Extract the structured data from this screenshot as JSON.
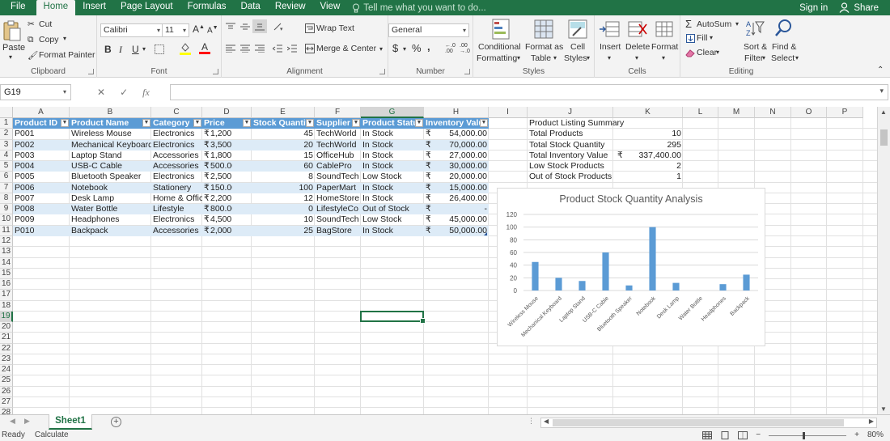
{
  "menu": {
    "tabs": [
      "File",
      "Home",
      "Insert",
      "Page Layout",
      "Formulas",
      "Data",
      "Review",
      "View"
    ],
    "active_tab": "Home",
    "tell_me": "Tell me what you want to do...",
    "sign_in": "Sign in",
    "share": "Share"
  },
  "ribbon": {
    "clipboard": {
      "label": "Clipboard",
      "paste": "Paste",
      "cut": "Cut",
      "copy": "Copy",
      "format_painter": "Format Painter"
    },
    "font": {
      "label": "Font",
      "name": "Calibri",
      "size": "11",
      "bold": "B",
      "italic": "I",
      "underline": "U"
    },
    "alignment": {
      "label": "Alignment",
      "wrap": "Wrap Text",
      "merge": "Merge & Center"
    },
    "number": {
      "label": "Number",
      "format": "General",
      "currency": "$",
      "percent": "%",
      "comma": ",",
      "inc_decimal": ".00",
      "dec_decimal": ".0"
    },
    "styles": {
      "label": "Styles",
      "conditional": "Conditional",
      "conditional2": "Formatting",
      "format_as": "Format as",
      "format_as2": "Table",
      "cell_styles": "Cell",
      "cell_styles2": "Styles"
    },
    "cells": {
      "label": "Cells",
      "insert": "Insert",
      "delete": "Delete",
      "format": "Format"
    },
    "editing": {
      "label": "Editing",
      "autosum": "AutoSum",
      "fill": "Fill",
      "clear": "Clear",
      "sort": "Sort &",
      "sort2": "Filter",
      "find": "Find &",
      "find2": "Select"
    }
  },
  "formula_bar": {
    "name_box": "G19",
    "fx": "fx",
    "value": ""
  },
  "columns": [
    "A",
    "B",
    "C",
    "D",
    "E",
    "F",
    "G",
    "H",
    "I",
    "J",
    "K",
    "L",
    "M",
    "N",
    "O",
    "P"
  ],
  "selected_column": "G",
  "selected_row": 19,
  "rows": 28,
  "table": {
    "headers": [
      "Product ID",
      "Product Name",
      "Category",
      "Price",
      "Stock Quantity",
      "Supplier",
      "Product Status",
      "Inventory Value"
    ],
    "currency_symbol": "₹",
    "rows": [
      [
        "P001",
        "Wireless Mouse",
        "Electronics",
        "1,200.00",
        "45",
        "TechWorld",
        "In Stock",
        "54,000.00"
      ],
      [
        "P002",
        "Mechanical Keyboard",
        "Electronics",
        "3,500.00",
        "20",
        "TechWorld",
        "In Stock",
        "70,000.00"
      ],
      [
        "P003",
        "Laptop Stand",
        "Accessories",
        "1,800.00",
        "15",
        "OfficeHub",
        "In Stock",
        "27,000.00"
      ],
      [
        "P004",
        "USB-C Cable",
        "Accessories",
        "500.00",
        "60",
        "CablePro",
        "In Stock",
        "30,000.00"
      ],
      [
        "P005",
        "Bluetooth Speaker",
        "Electronics",
        "2,500.00",
        "8",
        "SoundTech",
        "Low Stock",
        "20,000.00"
      ],
      [
        "P006",
        "Notebook",
        "Stationery",
        "150.00",
        "100",
        "PaperMart",
        "In Stock",
        "15,000.00"
      ],
      [
        "P007",
        "Desk Lamp",
        "Home & Office",
        "2,200.00",
        "12",
        "HomeStore",
        "In Stock",
        "26,400.00"
      ],
      [
        "P008",
        "Water Bottle",
        "Lifestyle",
        "800.00",
        "0",
        "LifestyleCo",
        "Out of Stock",
        "-"
      ],
      [
        "P009",
        "Headphones",
        "Electronics",
        "4,500.00",
        "10",
        "SoundTech",
        "Low Stock",
        "45,000.00"
      ],
      [
        "P010",
        "Backpack",
        "Accessories",
        "2,000.00",
        "25",
        "BagStore",
        "In Stock",
        "50,000.00"
      ]
    ]
  },
  "summary": {
    "title": "Product Listing Summary",
    "items": [
      {
        "label": "Total Products",
        "value": "10"
      },
      {
        "label": "Total Stock Quantity",
        "value": "295"
      },
      {
        "label": "Total Inventory Value",
        "currency": "₹",
        "value": "337,400.00"
      },
      {
        "label": "Low Stock Products",
        "value": "2"
      },
      {
        "label": "Out of Stock Products",
        "value": "1"
      }
    ]
  },
  "chart_data": {
    "type": "bar",
    "title": "Product Stock Quantity Analysis",
    "categories": [
      "Wireless Mouse",
      "Mechanical Keyboard",
      "Laptop Stand",
      "USB-C Cable",
      "Bluetooth Speaker",
      "Notebook",
      "Desk Lamp",
      "Water Bottle",
      "Headphones",
      "Backpack"
    ],
    "values": [
      45,
      20,
      15,
      60,
      8,
      100,
      12,
      0,
      10,
      25
    ],
    "ylim": [
      0,
      120
    ],
    "yticks": [
      "0",
      "20",
      "40",
      "60",
      "80",
      "100",
      "120"
    ],
    "grid": true,
    "bar_color": "#5b9bd5"
  },
  "sheet": {
    "tab": "Sheet1",
    "add": "+"
  },
  "status": {
    "ready": "Ready",
    "calculate": "Calculate",
    "zoom": "80%"
  },
  "colors": {
    "accent": "#217346",
    "table_header": "#5b9bd5",
    "band": "#ddebf7"
  }
}
